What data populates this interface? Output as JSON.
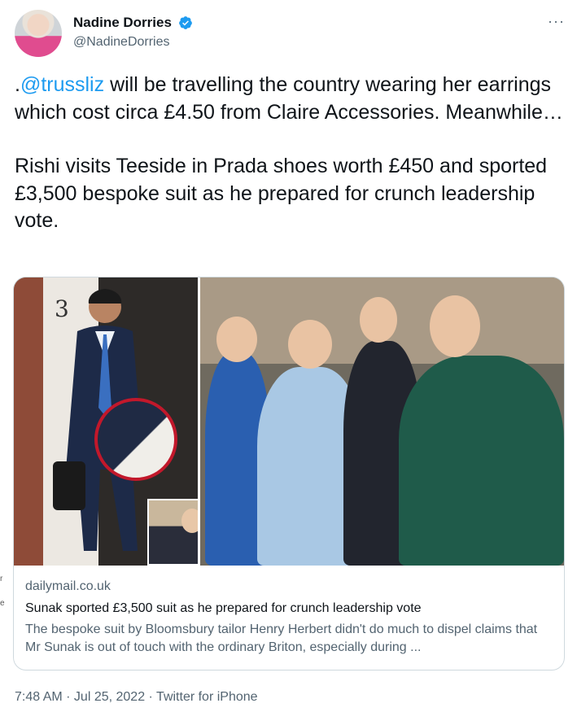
{
  "author": {
    "display_name": "Nadine Dorries",
    "handle": "@NadineDorries",
    "verified_icon": "verified-badge-icon",
    "avatar_icon": "avatar"
  },
  "more_icon": "···",
  "tweet": {
    "prefix": ".",
    "mention": "@trussliz",
    "paragraph1_rest": " will be travelling the country wearing her earrings which cost circa £4.50 from Claire Accessories. Meanwhile…",
    "paragraph2": "Rishi visits Teeside in Prada shoes worth £450 and sported £3,500 bespoke suit as he prepared for crunch leadership vote."
  },
  "card": {
    "image_number": "3",
    "domain": "dailymail.co.uk",
    "title": "Sunak sported £3,500 suit as he prepared for crunch leadership vote",
    "description": "The bespoke suit by Bloomsbury tailor Henry Herbert didn't do much to dispel claims that Mr Sunak is out of touch with the ordinary Briton, especially during ..."
  },
  "edge_fragments": [
    "r",
    "e"
  ],
  "footer": {
    "time": "7:48 AM",
    "separator1": " · ",
    "date": "Jul 25, 2022",
    "separator2": " · ",
    "source": "Twitter for iPhone"
  },
  "colors": {
    "accent": "#1d9bf0",
    "text": "#0f1419",
    "secondary": "#536471",
    "border": "#cfd9de"
  }
}
